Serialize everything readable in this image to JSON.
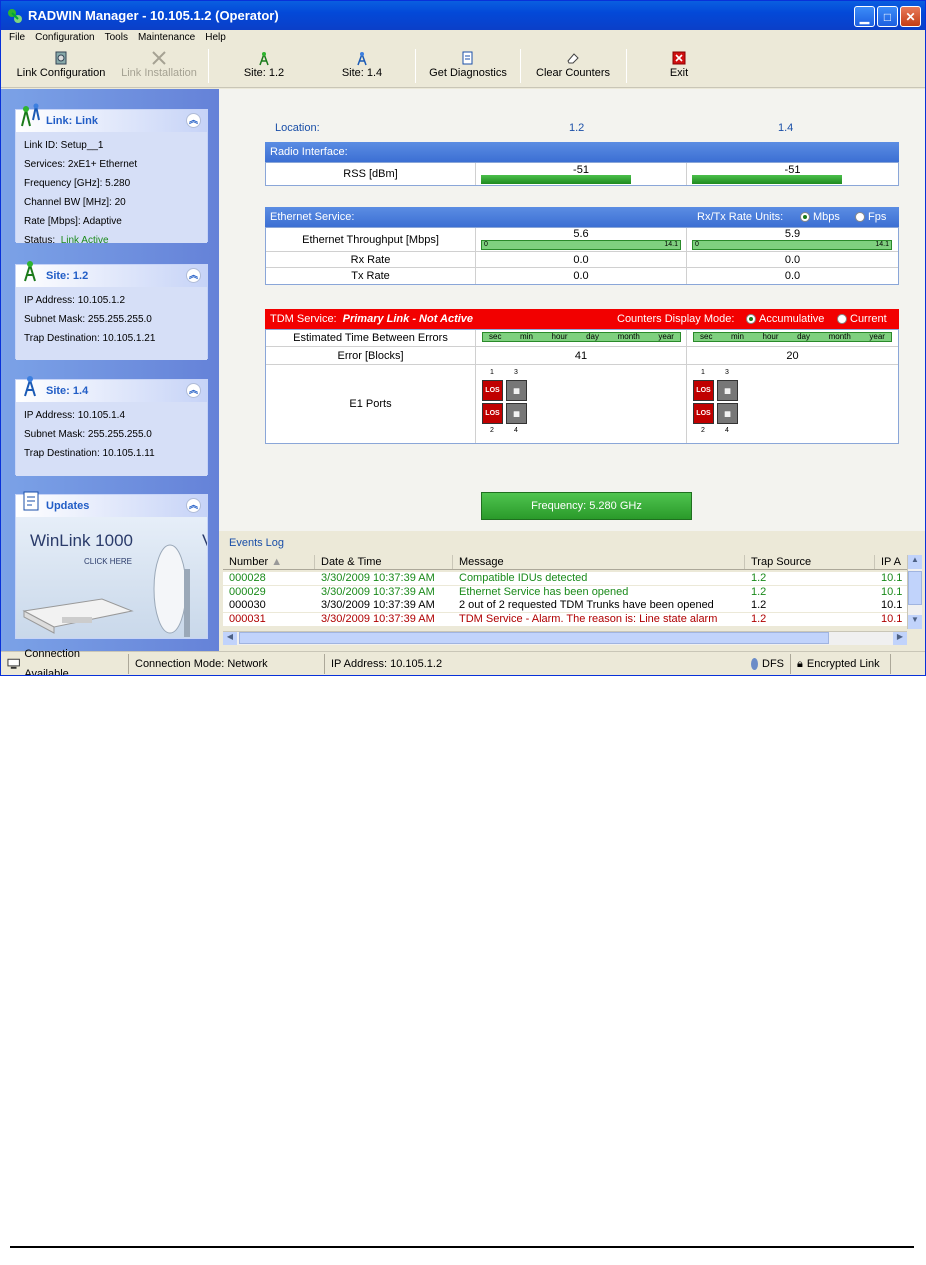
{
  "window": {
    "title": "RADWIN Manager - 10.105.1.2 (Operator)"
  },
  "menu": [
    "File",
    "Configuration",
    "Tools",
    "Maintenance",
    "Help"
  ],
  "toolbar": {
    "link_config": "Link Configuration",
    "link_install": "Link Installation",
    "site1": "Site: 1.2",
    "site2": "Site: 1.4",
    "diagnostics": "Get Diagnostics",
    "clear": "Clear Counters",
    "exit": "Exit"
  },
  "link_panel": {
    "title": "Link: Link",
    "link_id": "Link ID:   Setup__1",
    "services": "Services:   2xE1+ Ethernet",
    "frequency": "Frequency [GHz]:   5.280",
    "channel_bw": "Channel BW [MHz]:   20",
    "rate": "Rate [Mbps]:   Adaptive",
    "status_label": "Status:",
    "status_value": "Link Active"
  },
  "site1_panel": {
    "title": "Site: 1.2",
    "ip": "IP Address:   10.105.1.2",
    "mask": "Subnet Mask:   255.255.255.0",
    "trap": "Trap Destination:   10.105.1.21"
  },
  "site2_panel": {
    "title": "Site: 1.4",
    "ip": "IP Address:   10.105.1.4",
    "mask": "Subnet Mask:   255.255.255.0",
    "trap": "Trap Destination:   10.105.1.11"
  },
  "updates_panel": {
    "title": "Updates",
    "ad_title": "WinLink 1000",
    "ad_sub": "CLICK HERE"
  },
  "location": {
    "label": "Location:",
    "site1": "1.2",
    "site2": "1.4"
  },
  "radio": {
    "header": "Radio Interface:",
    "rss_label": "RSS [dBm]",
    "rss1": "-51",
    "rss2": "-51",
    "rss1_level": 0.75,
    "rss2_level": 0.75
  },
  "ethernet": {
    "header": "Ethernet Service:",
    "units_label": "Rx/Tx Rate Units:",
    "unit1": "Mbps",
    "unit2": "Fps",
    "throughput_label": "Ethernet Throughput [Mbps]",
    "tp1": "5.6",
    "tp2": "5.9",
    "scale_min": "0",
    "scale_max": "14.1",
    "rx_label": "Rx Rate",
    "tx_label": "Tx Rate",
    "rx1": "0.0",
    "rx2": "0.0",
    "tx1": "0.0",
    "tx2": "0.0"
  },
  "tdm": {
    "header": "TDM Service:",
    "status": "Primary Link - Not Active",
    "mode_label": "Counters Display Mode:",
    "mode1": "Accumulative",
    "mode2": "Current",
    "etbe_label": "Estimated Time Between Errors",
    "scale_units": [
      "sec",
      "min",
      "hour",
      "day",
      "month",
      "year"
    ],
    "error_label": "Error [Blocks]",
    "err1": "41",
    "err2": "20",
    "e1_label": "E1 Ports",
    "port_los": "LOS",
    "port_nums": [
      "1",
      "3",
      "2",
      "4"
    ]
  },
  "frequency_button": "Frequency: 5.280 GHz",
  "events": {
    "title": "Events Log",
    "columns": [
      "Number",
      "Date & Time",
      "Message",
      "Trap Source",
      "IP A"
    ],
    "rows": [
      {
        "num": "000028",
        "dt": "3/30/2009 10:37:39 AM",
        "msg": "Compatible IDUs detected",
        "src": "1.2",
        "ip": "10.1",
        "color": "#1a8a1a"
      },
      {
        "num": "000029",
        "dt": "3/30/2009 10:37:39 AM",
        "msg": "Ethernet Service has been opened",
        "src": "1.2",
        "ip": "10.1",
        "color": "#1a8a1a"
      },
      {
        "num": "000030",
        "dt": "3/30/2009 10:37:39 AM",
        "msg": "2 out of 2 requested TDM Trunks have been opened",
        "src": "1.2",
        "ip": "10.1",
        "color": "#000000"
      },
      {
        "num": "000031",
        "dt": "3/30/2009 10:37:39 AM",
        "msg": "TDM Service - Alarm. The reason is: Line state alarm",
        "src": "1.2",
        "ip": "10.1",
        "color": "#b00000"
      }
    ]
  },
  "statusbar": {
    "connection": "Connection Available",
    "mode": "Connection Mode: Network",
    "ip": "IP Address: 10.105.1.2",
    "dfs": "DFS",
    "encrypted": "Encrypted Link"
  }
}
